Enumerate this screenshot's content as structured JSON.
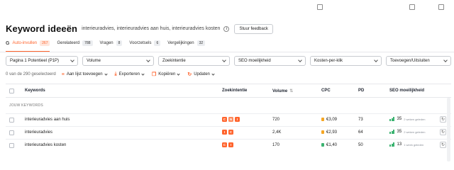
{
  "colors": {
    "accent": "#ff642d",
    "green": "#3cb371",
    "gray_badge": "#9aa0a8"
  },
  "header": {
    "title": "Keyword ideeën",
    "subtitle": "interieuradvies, interieuradvies aan huis, interieuradvies kosten",
    "feedback_label": "Stuur feedback"
  },
  "tabs": [
    {
      "label": "Auto-invullen",
      "count": "267"
    },
    {
      "label": "Gerelateerd",
      "count": "788"
    },
    {
      "label": "Vragen",
      "count": "8"
    },
    {
      "label": "Voorzetsels",
      "count": "6"
    },
    {
      "label": "Vergelijkingen",
      "count": "32"
    }
  ],
  "filters": [
    "Pagina 1 Potentieel (P1P)",
    "Volume",
    "Zoekintentie",
    "SEO moeilijkheid",
    "Kosten-per-klik",
    "Toevoegen/Uitsluiten"
  ],
  "actions": {
    "selected": "0 van de 290 geselecteerd",
    "add_to_list": "Aan lijst toevoegen",
    "export": "Exporteren",
    "copy": "Kopiëren",
    "update": "Updaten"
  },
  "table": {
    "columns": {
      "keywords": "Keywords",
      "intent": "Zoekintentie",
      "volume": "Volume",
      "cpc": "CPC",
      "pd": "PD",
      "seo": "SEO moeilijkheid"
    },
    "group_label": "JOUW KEYWORDS",
    "rows": [
      {
        "keyword": "interieuradvies aan huis",
        "intent": [
          "C",
          "N",
          "I"
        ],
        "volume": "720",
        "cpc": "€3,09",
        "cpc_color": "#f5a623",
        "pd": "73",
        "seo": "35",
        "updated": "2 weken geleden"
      },
      {
        "keyword": "interieuradvies",
        "intent": [
          "I",
          "C"
        ],
        "volume": "2,4K",
        "cpc": "€2,93",
        "cpc_color": "#f5a623",
        "pd": "64",
        "seo": "35",
        "updated": "2 weken geleden"
      },
      {
        "keyword": "interieuradvies kosten",
        "intent": [
          "C",
          "I"
        ],
        "volume": "170",
        "cpc": "€1,40",
        "cpc_color": "#3cb371",
        "pd": "50",
        "seo": "13",
        "updated": "1 week geleden"
      }
    ]
  }
}
